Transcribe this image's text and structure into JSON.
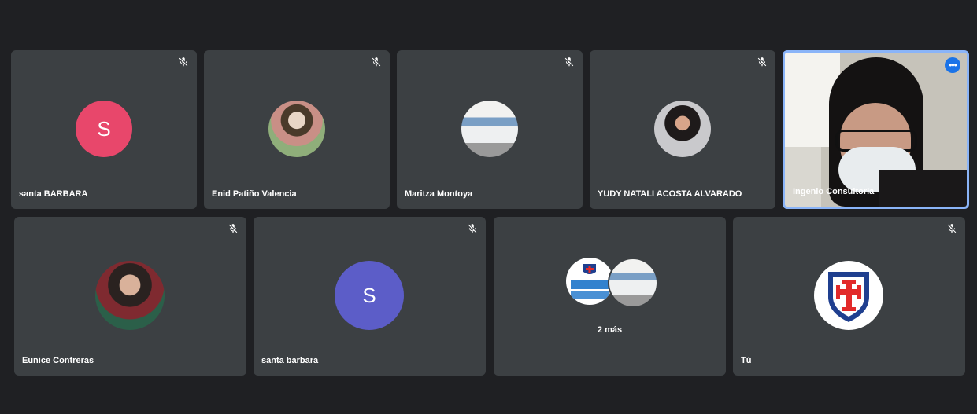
{
  "colors": {
    "background": "#1f2023",
    "tile": "#3c4043",
    "active_border": "#8ab4f8",
    "avatar_pink": "#e8476b",
    "avatar_purple": "#5c5dc8",
    "more_button": "#1a73e8"
  },
  "icons": {
    "mute": "mic-off-icon",
    "more": "more-options-icon"
  },
  "participants": [
    {
      "name": "santa BARBARA",
      "avatar_initial": "S",
      "muted": true
    },
    {
      "name": "Enid Patiño Valencia",
      "avatar_initial": "",
      "muted": true
    },
    {
      "name": "Maritza Montoya",
      "avatar_initial": "",
      "muted": true
    },
    {
      "name": "YUDY NATALI ACOSTA ALVARADO",
      "avatar_initial": "",
      "muted": true
    },
    {
      "name": "Ingenio Consultoria",
      "avatar_initial": "",
      "muted": false,
      "active_speaker": true
    },
    {
      "name": "Eunice Contreras",
      "avatar_initial": "",
      "muted": true
    },
    {
      "name": "santa barbara",
      "avatar_initial": "S",
      "muted": true
    },
    {
      "name": "",
      "more_label": "2 más"
    },
    {
      "name": "Tú",
      "avatar_initial": "",
      "muted": true
    }
  ]
}
